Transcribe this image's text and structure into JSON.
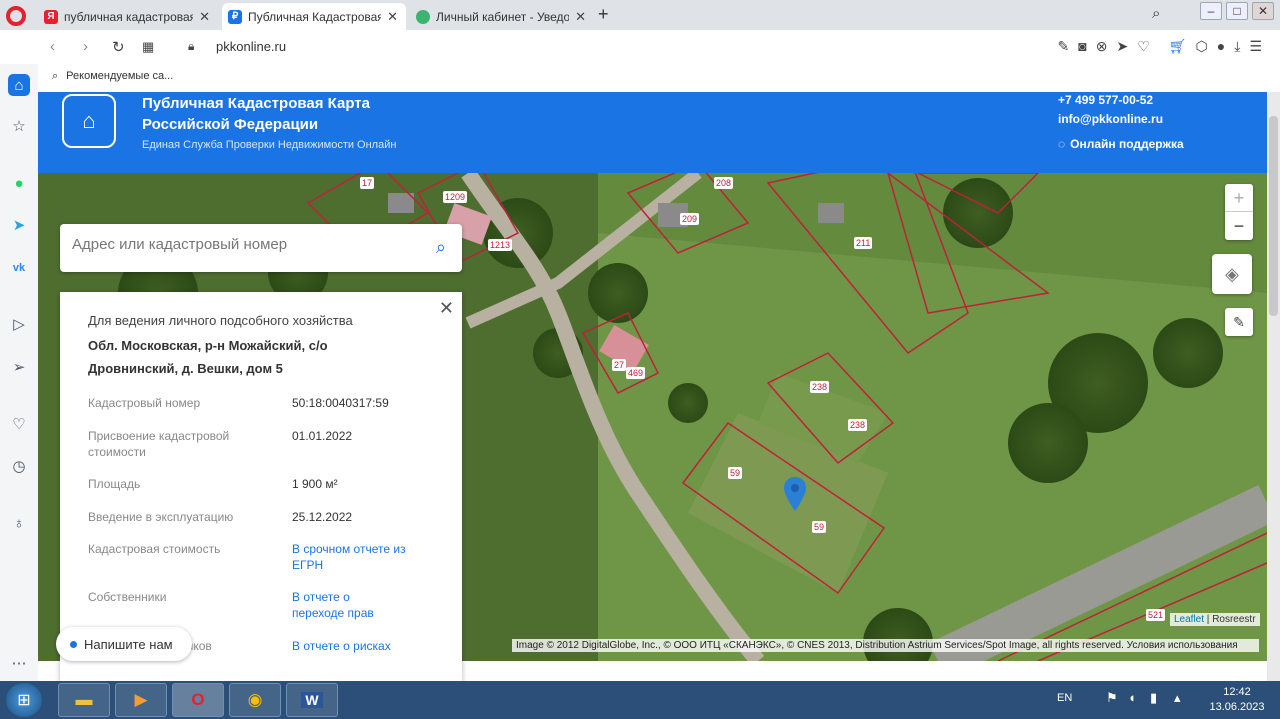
{
  "browser": {
    "tabs": [
      {
        "title": "публичная кадастровая к",
        "favicon": "yandex-favicon",
        "color": "#e8202d",
        "glyph": "Я"
      },
      {
        "title": "Публичная Кадастровая к",
        "favicon": "pkk-favicon",
        "color": "#1b74e4",
        "glyph": "₽"
      },
      {
        "title": "Личный кабинет - Уведо",
        "favicon": "lk-favicon",
        "color": "#3cb371",
        "glyph": "●"
      }
    ],
    "url": "pkkonline.ru",
    "bookmark": "Рекомендуемые са..."
  },
  "site": {
    "title": "Публичная Кадастровая Карта Российской Федерации",
    "subtitle": "Единая Служба Проверки Недвижимости Онлайн",
    "phone": "+7 499 577-00-52",
    "email": "info@pkkonline.ru",
    "support": "Онлайн поддержка"
  },
  "search": {
    "placeholder": "Адрес или кадастровый номер"
  },
  "panel": {
    "type": "Для ведения личного подсобного хозяйства",
    "address": "Обл. Московская, р-н Можайский, с/о Дровнинский, д. Вешки, дом 5",
    "rows": [
      {
        "label": "Кадастровый номер",
        "value": "50:18:0040317:59"
      },
      {
        "label": "Присвоение кадастровой стоимости",
        "value": "01.01.2022"
      },
      {
        "label": "Площадь",
        "value": "1 900 м²"
      },
      {
        "label": "Введение в эксплуатацию",
        "value": "25.12.2022"
      },
      {
        "label": "Кадастровая стоимость",
        "value": "В срочном отчете из ЕГРН"
      },
      {
        "label": "Собственники",
        "value": "В отчете о переходе прав"
      },
      {
        "label": "ников",
        "value": "В отчете о рисках"
      }
    ]
  },
  "chat": {
    "label": "Напишите нам"
  },
  "map": {
    "parcel_labels": [
      "17",
      "1209",
      "1213",
      "208",
      "209",
      "211",
      "27",
      "469",
      "238",
      "238",
      "59",
      "59",
      "521"
    ],
    "attribution_short": {
      "leaflet": "Leaflet",
      "rosreestr": "Rosreestr"
    },
    "attribution_long": "Image © 2012 DigitalGlobe, Inc., © ООО ИТЦ «СКАНЭКС», © CNES 2013, Distribution Astrium Services/Spot Image, all rights reserved. Условия использования"
  },
  "taskbar": {
    "lang": "EN",
    "time": "12:42",
    "date": "13.06.2023"
  }
}
